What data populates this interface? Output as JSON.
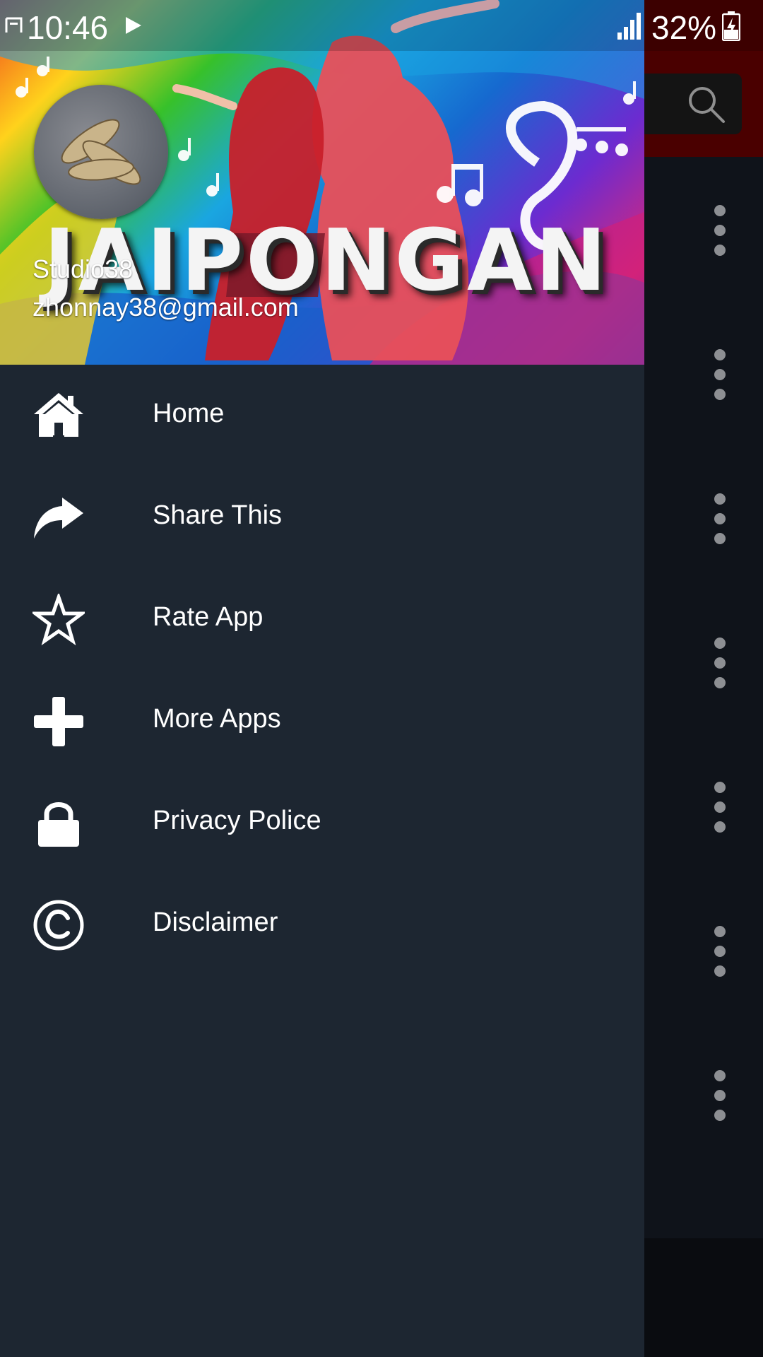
{
  "status_bar": {
    "time": "10:46",
    "battery": "32%",
    "icons": [
      "notification-icon",
      "play-icon",
      "signal-icon",
      "battery-charging-icon"
    ]
  },
  "drawer": {
    "header": {
      "wordmark": "JAIPONGAN",
      "name": "Studio38",
      "email": "zhonnay38@gmail.com"
    },
    "items": [
      {
        "label": "Home",
        "icon": "home-icon"
      },
      {
        "label": "Share This",
        "icon": "share-icon"
      },
      {
        "label": "Rate App",
        "icon": "star-icon"
      },
      {
        "label": "More Apps",
        "icon": "plus-icon"
      },
      {
        "label": "Privacy Police",
        "icon": "lock-icon"
      },
      {
        "label": "Disclaimer",
        "icon": "copyright-icon"
      }
    ]
  },
  "background": {
    "toolbar_color": "#4a0000",
    "search_icon": "search-icon",
    "overflow_icon": "more-vertical-icon"
  },
  "colors": {
    "drawer_bg": "#1d2631",
    "text": "#ffffff"
  }
}
